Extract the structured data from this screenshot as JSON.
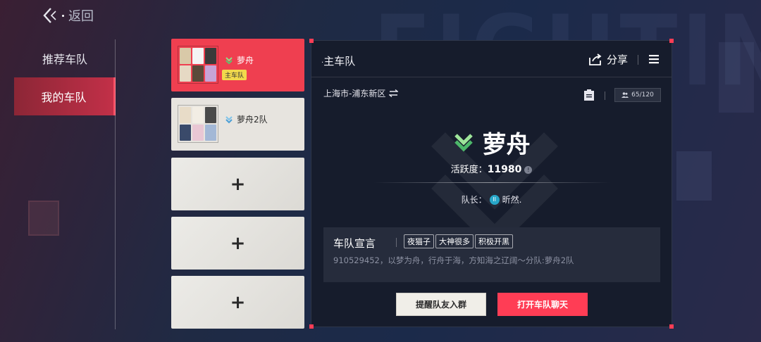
{
  "header": {
    "back_label": "返回"
  },
  "nav": {
    "items": [
      {
        "label": "推荐车队",
        "active": false
      },
      {
        "label": "我的车队",
        "active": true
      }
    ]
  },
  "slots": {
    "team1": {
      "name": "萝舟",
      "badge": "主车队"
    },
    "team2": {
      "name": "萝舟2队"
    },
    "empty_label": "+"
  },
  "panel": {
    "title": "主车队",
    "share_label": "分享",
    "location": "上海市-浦东新区",
    "members": "65/120",
    "team_name": "萝舟",
    "activity_label": "活跃度：",
    "activity_value": "11980",
    "captain_label": "队长：",
    "captain_name": "昕然.",
    "declaration": {
      "title": "车队宣言",
      "tags": [
        "夜猫子",
        "大神很多",
        "积极开黑"
      ],
      "text": "910529452，以梦为舟，行舟于海，方知海之辽阔～分队:萝舟2队"
    },
    "buttons": {
      "remind": "提醒队友入群",
      "chat": "打开车队聊天"
    }
  },
  "background": {
    "watermark": "FIGHTING"
  },
  "colors": {
    "accent": "#ff3d55",
    "badge": "#f2d94c",
    "active_slot": "#ef3f50",
    "panel": "#161c2c"
  }
}
